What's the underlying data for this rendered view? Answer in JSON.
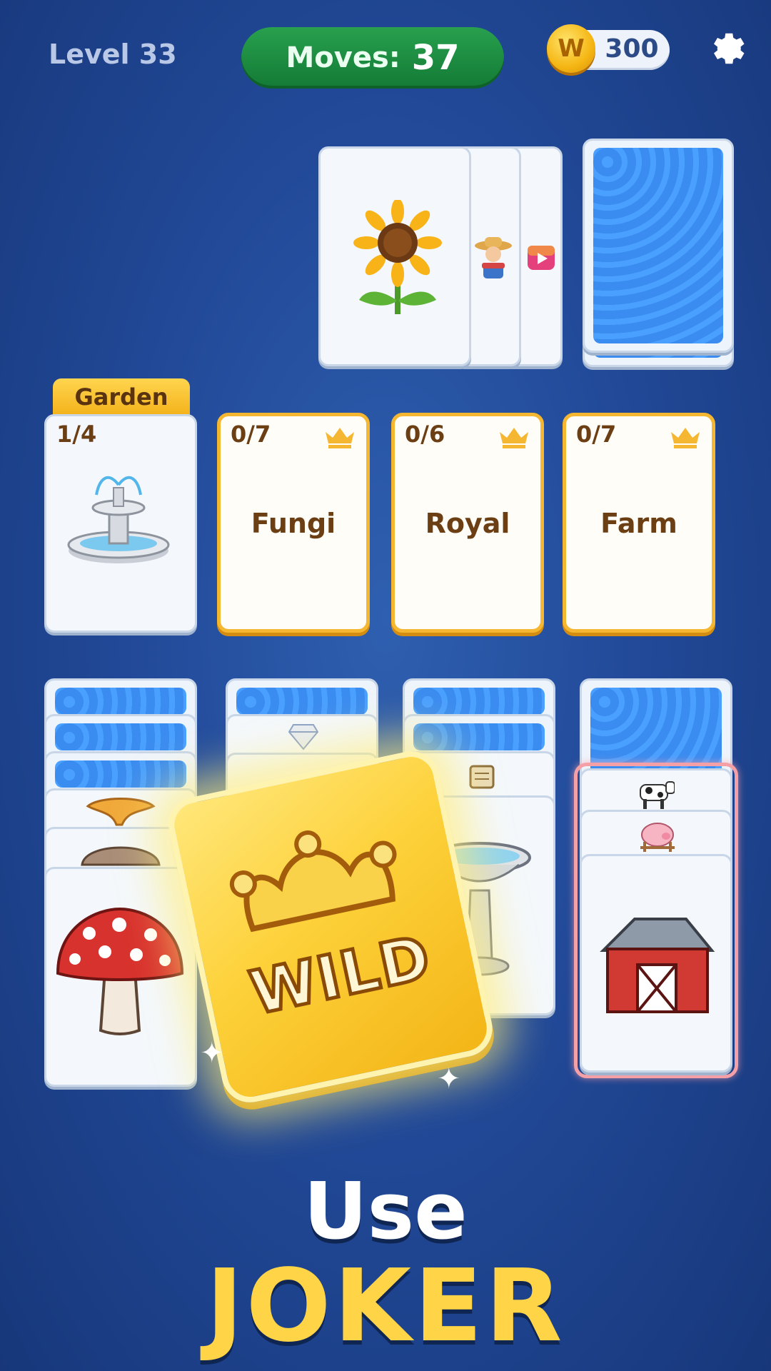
{
  "hud": {
    "level": "Level 33",
    "moves_label": "Moves:",
    "moves_value": "37",
    "coins": "300",
    "coin_letter": "W"
  },
  "foundations": [
    {
      "tab": "Garden",
      "count": "1/4",
      "icon": "fountain-icon"
    },
    {
      "count": "0/7",
      "name": "Fungi",
      "icon": "crown-icon"
    },
    {
      "count": "0/6",
      "name": "Royal",
      "icon": "crown-icon"
    },
    {
      "count": "0/7",
      "name": "Farm",
      "icon": "crown-icon"
    }
  ],
  "waste": {
    "top": "sunflower-icon",
    "under": [
      "farmer-icon",
      "video-icon"
    ]
  },
  "tableau": [
    {
      "faces": [
        "chanterelle-icon",
        "oyster-mushroom-icon",
        "toadstool-icon"
      ]
    },
    {
      "faces": [
        "diamond-icon"
      ]
    },
    {
      "faces": [
        "scroll-icon",
        "birdbath-icon"
      ]
    },
    {
      "faces": [
        "cow-icon",
        "pig-icon",
        "barn-icon"
      ],
      "highlighted": true
    }
  ],
  "wild_card": {
    "label": "WILD"
  },
  "promo": {
    "line1": "Use",
    "line2": "JOKER"
  },
  "colors": {
    "accent": "#f5b731",
    "moves_green": "#1d8d40",
    "card_back": "#3f93f7"
  }
}
